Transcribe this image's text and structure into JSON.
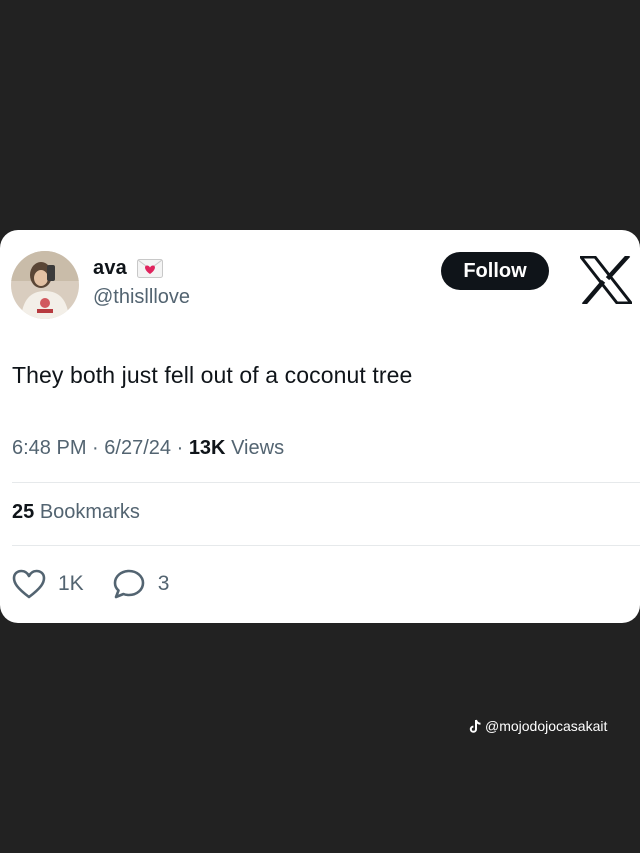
{
  "tweet": {
    "author": {
      "display_name": "ava",
      "handle": "@thislllove",
      "name_badge": "envelope-with-heart-icon"
    },
    "follow_label": "Follow",
    "text": "They both just fell out of a coconut tree",
    "meta": {
      "time": "6:48 PM",
      "separator": "·",
      "date": "6/27/24",
      "views_count": "13K",
      "views_label": "Views"
    },
    "bookmarks": {
      "count": "25",
      "label": "Bookmarks"
    },
    "actions": {
      "likes": "1K",
      "replies": "3"
    }
  },
  "watermark": {
    "platform_icon": "tiktok-icon",
    "handle": "@mojodojocasakait"
  },
  "colors": {
    "background": "#222222",
    "card": "#ffffff",
    "primary_text": "#0f1419",
    "secondary_text": "#536471",
    "heart_badge": "#e0245e"
  }
}
